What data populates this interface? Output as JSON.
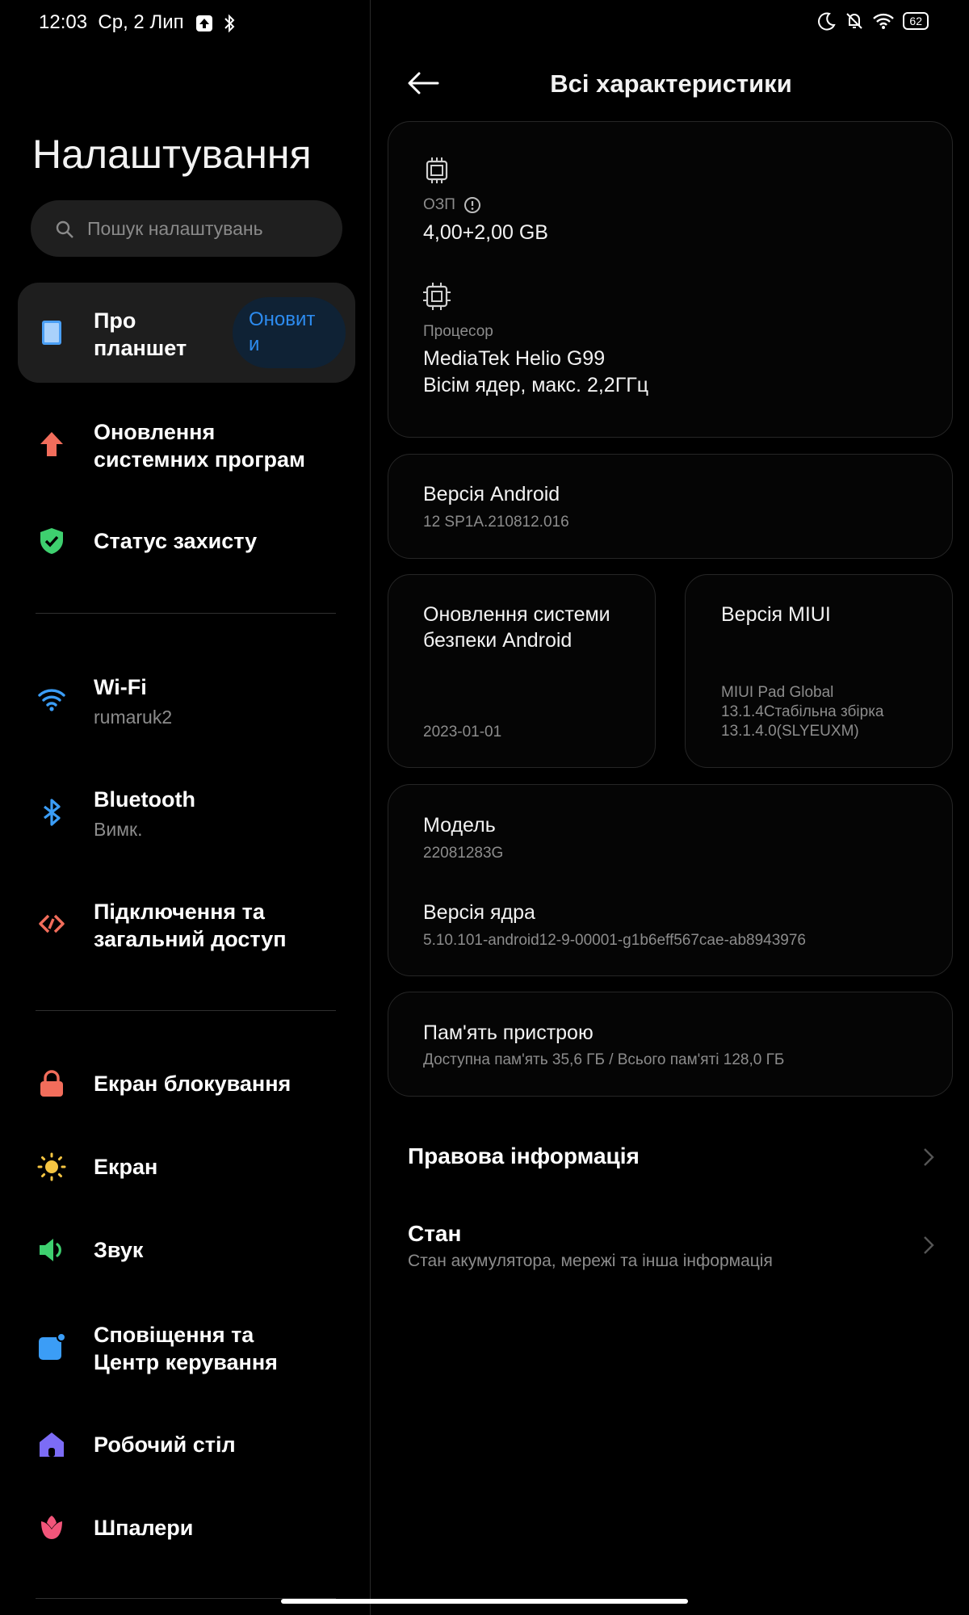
{
  "status": {
    "time": "12:03",
    "date": "Ср, 2 Лип",
    "battery": "62"
  },
  "left": {
    "title": "Налаштування",
    "search_placeholder": "Пошук налаштувань",
    "items": [
      {
        "label": "Про\nпланшет",
        "badge": "Оновит\nи",
        "icon": "tablet-icon",
        "color": "#4a9ff5"
      },
      {
        "label": "Оновлення\nсистемних програм",
        "icon": "update-arrow-icon",
        "color": "#f26d5b"
      },
      {
        "label": "Статус захисту",
        "icon": "shield-check-icon",
        "color": "#3ed06f"
      },
      {
        "label": "Wi-Fi",
        "sub": "rumaruk2",
        "icon": "wifi-icon",
        "color": "#3b9df6"
      },
      {
        "label": "Bluetooth",
        "sub": "Вимк.",
        "icon": "bluetooth-icon",
        "color": "#3b9df6"
      },
      {
        "label": "Підключення та\nзагальний доступ",
        "icon": "share-icon",
        "color": "#f26d5b"
      },
      {
        "label": "Екран блокування",
        "icon": "lock-icon",
        "color": "#f26d5b"
      },
      {
        "label": "Екран",
        "icon": "sun-icon",
        "color": "#f5c542"
      },
      {
        "label": "Звук",
        "icon": "speaker-icon",
        "color": "#3ed06f"
      },
      {
        "label": "Сповіщення та\nЦентр керування",
        "icon": "notification-icon",
        "color": "#3b9df6"
      },
      {
        "label": "Робочий стіл",
        "icon": "home-icon",
        "color": "#7c6cf6"
      },
      {
        "label": "Шпалери",
        "icon": "tulip-icon",
        "color": "#f2557a"
      }
    ]
  },
  "right": {
    "title": "Всі характеристики",
    "ram_label": "ОЗП",
    "ram_value": "4,00+2,00 GB",
    "cpu_label": "Процесор",
    "cpu_line1": "MediaTek Helio G99",
    "cpu_line2": "Вісім ядер, макс. 2,2ГГц",
    "android_label": "Версія Android",
    "android_value": "12 SP1A.210812.016",
    "security_label": "Оновлення системи\nбезпеки Android",
    "security_value": "2023-01-01",
    "miui_label": "Версія MIUI",
    "miui_value": "MIUI Pad Global\n13.1.4Стабільна збірка\n13.1.4.0(SLYEUXM)",
    "model_label": "Модель",
    "model_value": "22081283G",
    "kernel_label": "Версія ядра",
    "kernel_value": "5.10.101-android12-9-00001-g1b6eff567cae-ab8943976",
    "storage_label": "Пам'ять пристрою",
    "storage_value": "Доступна пам'ять  35,6 ГБ / Всього пам'яті  128,0 ГБ",
    "legal_label": "Правова інформація",
    "state_label": "Стан",
    "state_sub": "Стан акумулятора, мережі та інша інформація"
  }
}
